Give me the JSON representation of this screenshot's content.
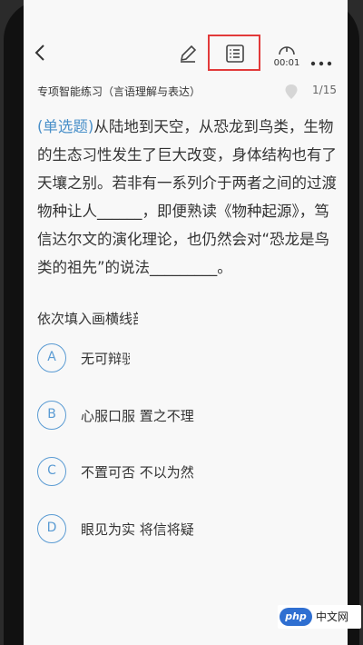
{
  "header": {
    "timer": "00:01"
  },
  "subheader": {
    "category": "专项智能练习（言语理解与表达）",
    "progress": "1/15"
  },
  "question": {
    "type_tag": "(单选题)",
    "stem": "从陆地到天空，从恐龙到鸟类，生物的生态习性发生了巨大改变，身体结构也有了天壤之别。若非有一系列介于两者之间的过渡物种让人______，即便熟读《物种起源》，笃信达尔文的演化理论，也仍然会对“恐龙是鸟类的祖先”的说法_________。",
    "instruction": "依次填入画横线部分最恰当的一项是："
  },
  "options": [
    {
      "letter": "A",
      "text": "无可辩驳"
    },
    {
      "letter": "B",
      "text": "心服口服  置之不理"
    },
    {
      "letter": "C",
      "text": "不置可否  不以为然"
    },
    {
      "letter": "D",
      "text": "眼见为实  将信将疑"
    }
  ],
  "watermark": {
    "logo": "php",
    "text": "中文网"
  },
  "colors": {
    "accent": "#5a9bd3",
    "highlight_box": "#e23a3a"
  },
  "icons": [
    "back-arrow-icon",
    "pencil-icon",
    "answer-sheet-icon",
    "timer-icon",
    "more-icon",
    "location-pin-icon"
  ]
}
